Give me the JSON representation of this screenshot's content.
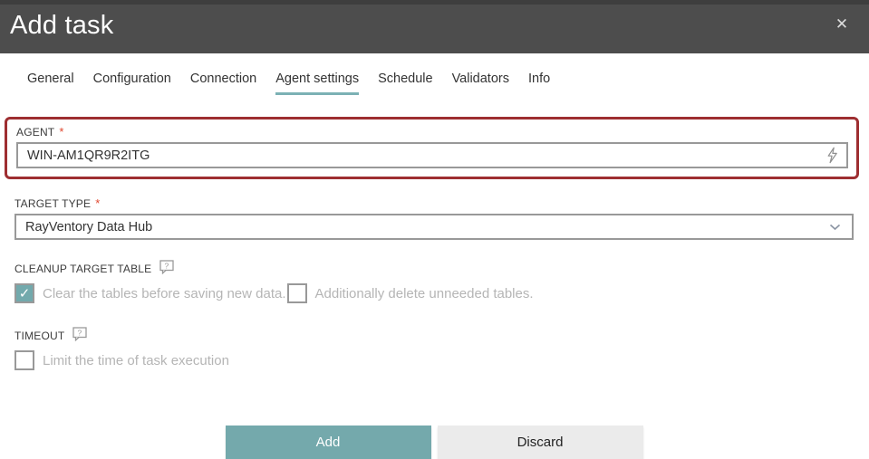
{
  "dialog": {
    "title": "Add task"
  },
  "icons": {
    "close": "✕",
    "check": "✓",
    "help": "?"
  },
  "tabs": [
    {
      "label": "General"
    },
    {
      "label": "Configuration"
    },
    {
      "label": "Connection"
    },
    {
      "label": "Agent settings"
    },
    {
      "label": "Schedule"
    },
    {
      "label": "Validators"
    },
    {
      "label": "Info"
    }
  ],
  "active_tab": "Agent settings",
  "form": {
    "agent": {
      "label": "AGENT",
      "required_marker": "*",
      "value": "WIN-AM1QR9R2ITG"
    },
    "target_type": {
      "label": "TARGET TYPE",
      "required_marker": "*",
      "value": "RayVentory Data Hub"
    },
    "cleanup": {
      "label": "CLEANUP TARGET TABLE",
      "clear_checkbox": {
        "label": "Clear the tables before saving new data.",
        "checked": true
      },
      "delete_checkbox": {
        "label": "Additionally delete unneeded tables.",
        "checked": false
      }
    },
    "timeout": {
      "label": "TIMEOUT",
      "limit_checkbox": {
        "label": "Limit the time of task execution",
        "checked": false
      }
    }
  },
  "buttons": {
    "add": "Add",
    "discard": "Discard"
  },
  "colors": {
    "header_bg": "#4d4d4d",
    "accent_teal": "#74a9ac",
    "tab_underline": "#7cb1b4",
    "annotation_border": "#9e2e31",
    "required_asterisk": "#e0472f",
    "field_border": "#999999",
    "disabled_text": "#b5b5b5"
  }
}
